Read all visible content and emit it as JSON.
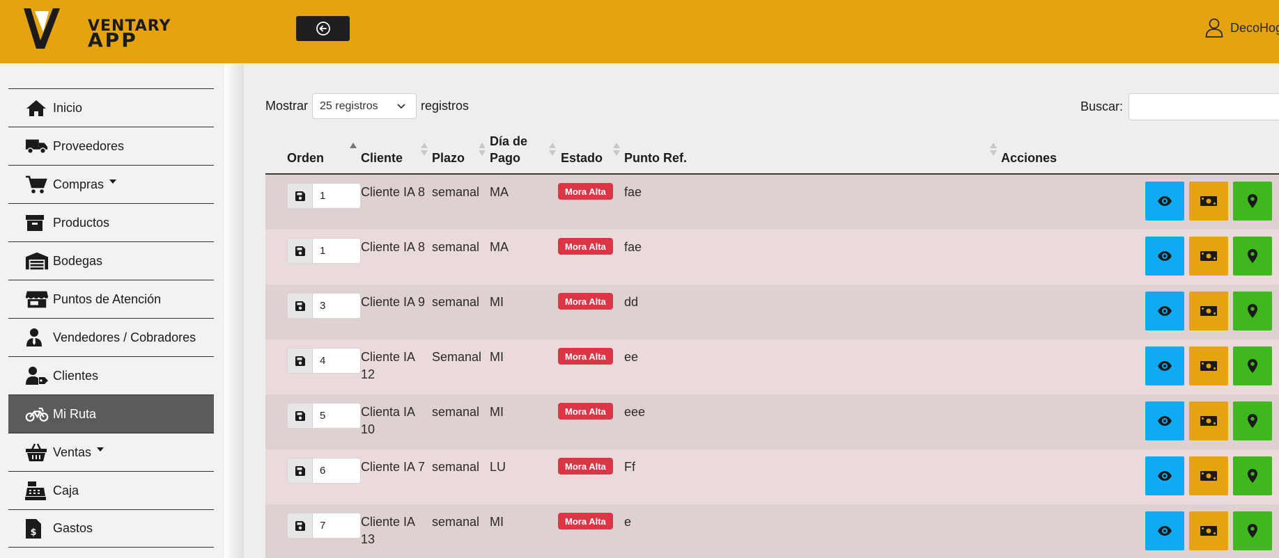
{
  "brand": {
    "line1": "VENTARY",
    "line2": "APP"
  },
  "header": {
    "user_name": "DecoHogar"
  },
  "sidebar": {
    "items": [
      {
        "label": "Inicio",
        "icon": "home-icon"
      },
      {
        "label": "Proveedores",
        "icon": "truck-icon"
      },
      {
        "label": "Compras",
        "icon": "cart-icon",
        "dropdown": true
      },
      {
        "label": "Productos",
        "icon": "archive-box-icon"
      },
      {
        "label": "Bodegas",
        "icon": "warehouse-icon"
      },
      {
        "label": "Puntos de Atención",
        "icon": "store-icon"
      },
      {
        "label": "Vendedores / Cobradores",
        "icon": "user-tie-icon"
      },
      {
        "label": "Clientes",
        "icon": "user-tag-icon"
      },
      {
        "label": "Mi Ruta",
        "icon": "motorcycle-icon",
        "active": true
      },
      {
        "label": "Ventas",
        "icon": "basket-icon",
        "dropdown": true
      },
      {
        "label": "Caja",
        "icon": "cash-register-icon"
      },
      {
        "label": "Gastos",
        "icon": "invoice-dollar-icon"
      }
    ]
  },
  "controls": {
    "show_label": "Mostrar",
    "page_size": "25 registros",
    "records_label": "registros",
    "search_label": "Buscar:",
    "search_value": ""
  },
  "table": {
    "headers": {
      "orden": "Orden",
      "cliente": "Cliente",
      "plazo": "Plazo",
      "dia_pago_1": "Día de",
      "dia_pago_2": "Pago",
      "estado": "Estado",
      "punto_ref": "Punto Ref.",
      "acciones": "Acciones"
    },
    "rows": [
      {
        "orden": "1",
        "cliente": "Cliente IA 8",
        "plazo": "semanal",
        "dia": "MA",
        "estado": "Mora Alta",
        "ref": "fae"
      },
      {
        "orden": "1",
        "cliente": "Cliente IA 8",
        "plazo": "semanal",
        "dia": "MA",
        "estado": "Mora Alta",
        "ref": "fae"
      },
      {
        "orden": "3",
        "cliente": "Cliente IA 9",
        "plazo": "semanal",
        "dia": "MI",
        "estado": "Mora Alta",
        "ref": "dd"
      },
      {
        "orden": "4",
        "cliente": "Cliente IA 12",
        "plazo": "Semanal",
        "dia": "MI",
        "estado": "Mora Alta",
        "ref": "ee"
      },
      {
        "orden": "5",
        "cliente": "Clienta IA 10",
        "plazo": "semanal",
        "dia": "MI",
        "estado": "Mora Alta",
        "ref": "eee"
      },
      {
        "orden": "6",
        "cliente": "Cliente IA 7",
        "plazo": "semanal",
        "dia": "LU",
        "estado": "Mora Alta",
        "ref": "Ff"
      },
      {
        "orden": "7",
        "cliente": "Cliente IA 13",
        "plazo": "semanal",
        "dia": "MI",
        "estado": "Mora Alta",
        "ref": "e"
      }
    ]
  },
  "colors": {
    "header_bg": "#e4a30f",
    "active_nav": "#5b5b5b",
    "badge_red": "#dc3545",
    "view_btn": "#0eaaf2",
    "pay_btn": "#e4a30f",
    "map_btn": "#3fb71d"
  }
}
